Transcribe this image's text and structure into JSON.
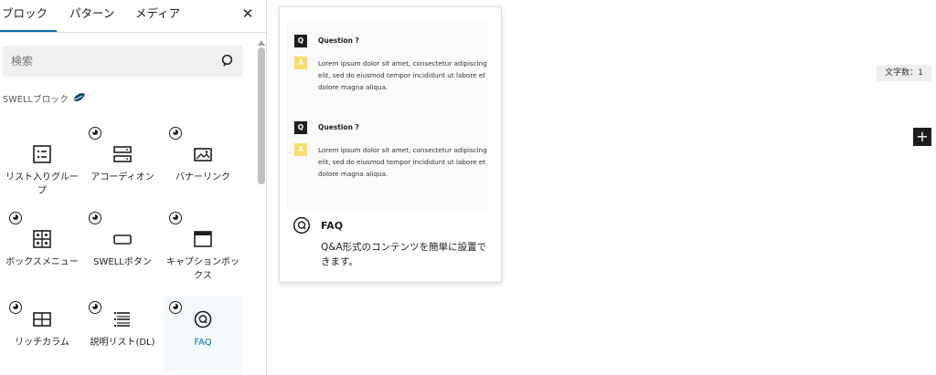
{
  "tabs": [
    {
      "label": "ブロック"
    },
    {
      "label": "パターン"
    },
    {
      "label": "メディア"
    }
  ],
  "close_glyph": "✕",
  "search": {
    "placeholder": "検索",
    "icon": "search-icon"
  },
  "category": {
    "label": "SWELLブロック",
    "icon": "swell-logo-icon"
  },
  "blocks": [
    {
      "label": "リスト入りグループ",
      "icon": "list-group-icon",
      "badge": false
    },
    {
      "label": "アコーディオン",
      "icon": "accordion-icon",
      "badge": true
    },
    {
      "label": "バナーリンク",
      "icon": "banner-link-icon",
      "badge": true
    },
    {
      "label": "ボックスメニュー",
      "icon": "box-menu-icon",
      "badge": true
    },
    {
      "label": "SWELLボタン",
      "icon": "button-icon",
      "badge": true
    },
    {
      "label": "キャプションボックス",
      "icon": "caption-box-icon",
      "badge": true
    },
    {
      "label": "リッチカラム",
      "icon": "rich-column-icon",
      "badge": true
    },
    {
      "label": "説明リスト(DL)",
      "icon": "dl-list-icon",
      "badge": true
    },
    {
      "label": "FAQ",
      "icon": "faq-icon",
      "badge": true,
      "active": true
    }
  ],
  "preview": {
    "q1": "Question ?",
    "a1": "Lorem ipsum dolor sit amet, consectetur adipiscing elit, sed do eiusmod tempor incididunt ut labore et dolore magna aliqua.",
    "q2": "Question ?",
    "a2": "Lorem ipsum dolor sit amet, consectetur adipiscing elit, sed do eiusmod tempor incididunt ut labore et dolore magna aliqua.",
    "q_badge": "Q",
    "a_badge": "A",
    "title": "FAQ",
    "description": "Q&A形式のコンテンツを簡単に設置できます。"
  },
  "editor": {
    "char_count_label": "文字数：1",
    "add_block_glyph": "+"
  },
  "colors": {
    "accent": "#0b6fa4",
    "answer_badge": "#f7dc6f",
    "question_badge": "#1e1e1e"
  }
}
